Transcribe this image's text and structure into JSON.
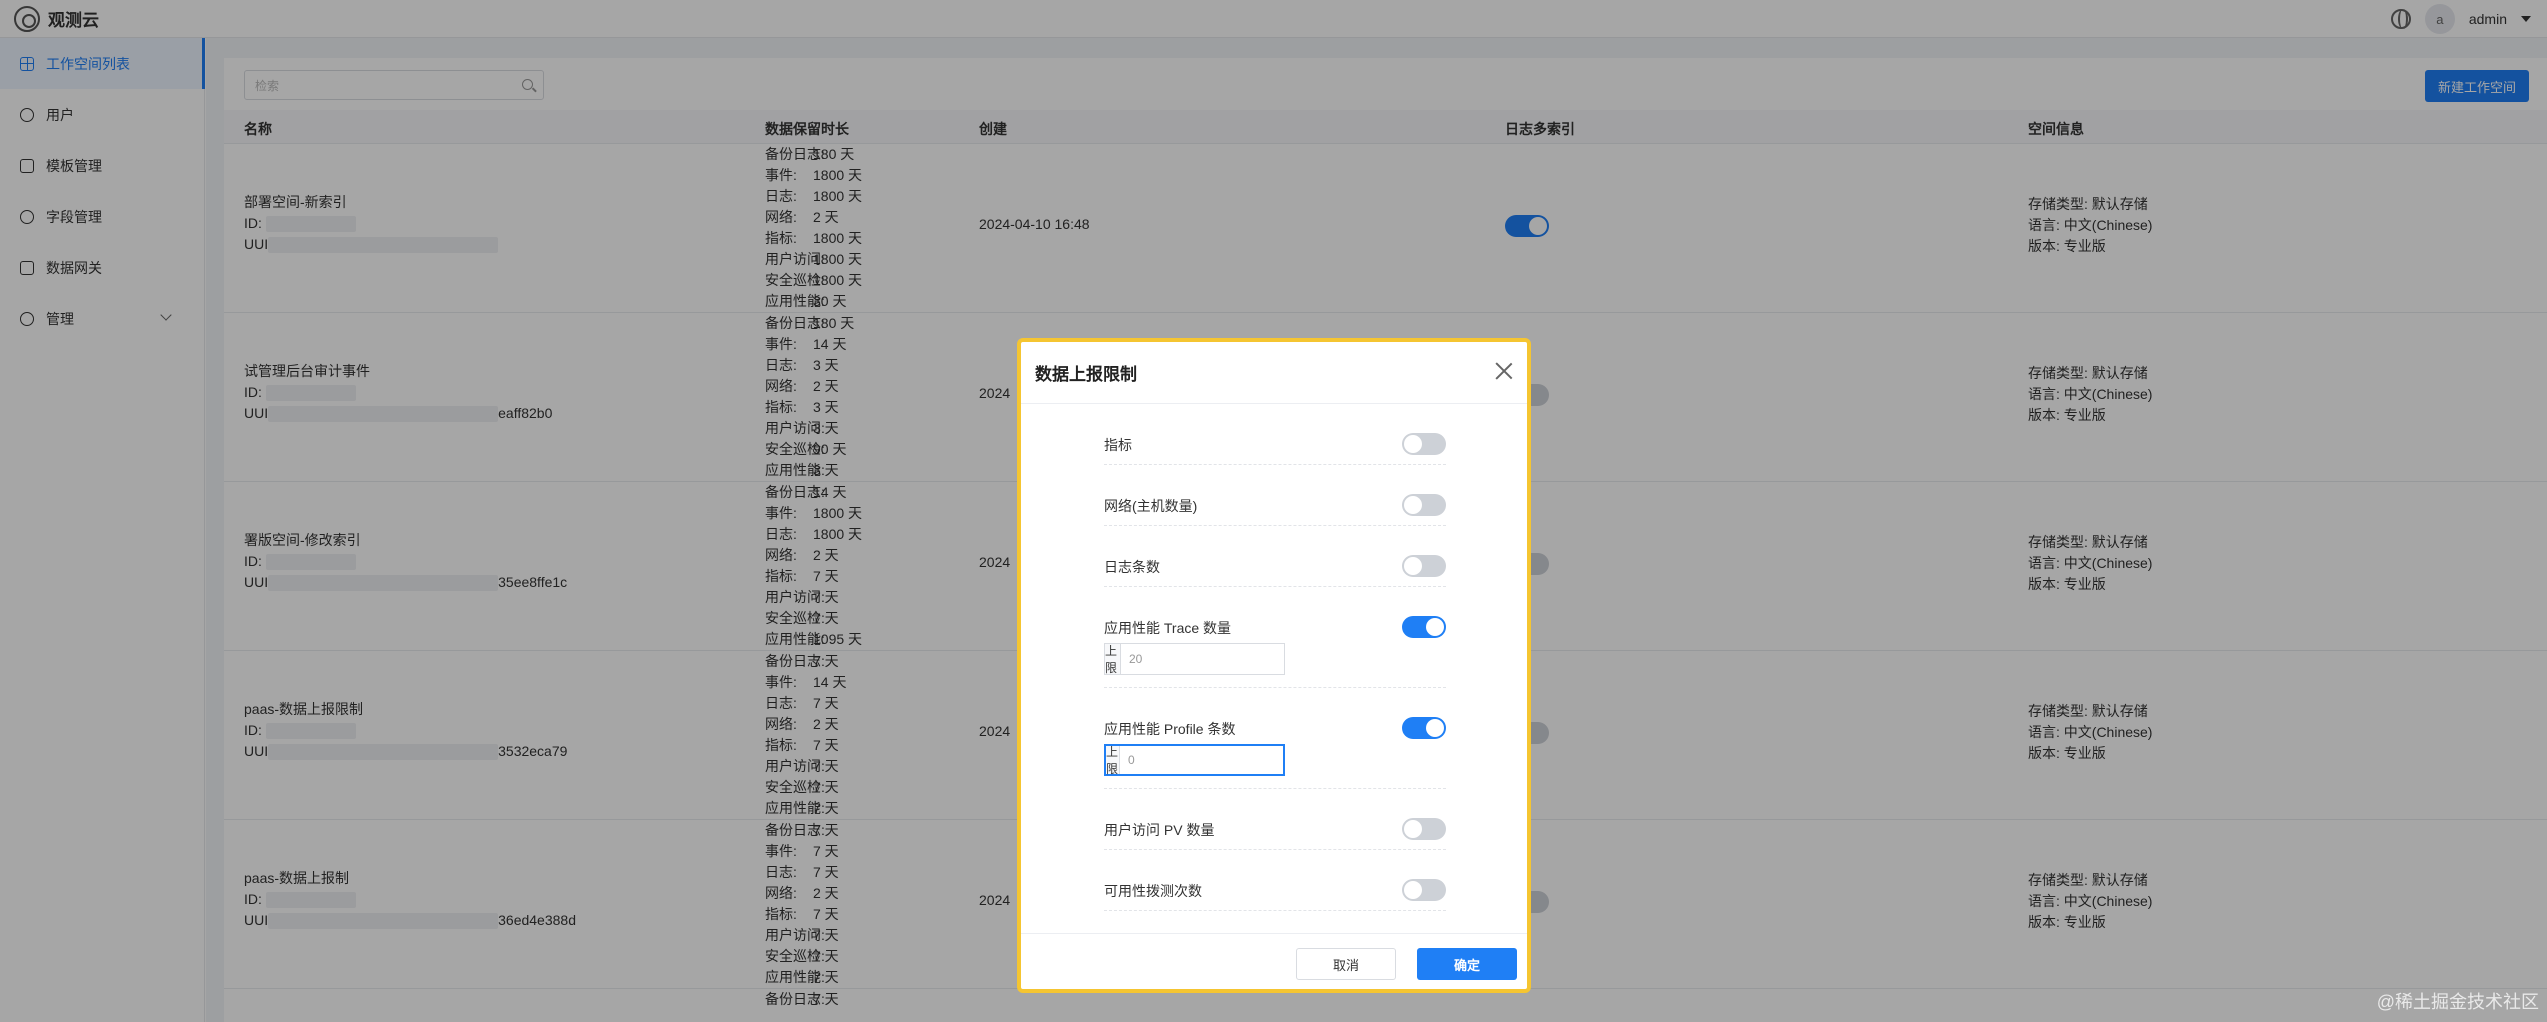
{
  "app": {
    "title": "观测云"
  },
  "header": {
    "user_initial": "a",
    "user_name": "admin",
    "icons": [
      "globe-icon",
      "chevron-down-icon"
    ]
  },
  "sidebar": {
    "items": [
      {
        "label": "工作空间列表",
        "icon": "grid-icon",
        "active": true
      },
      {
        "label": "用户",
        "icon": "users-icon"
      },
      {
        "label": "模板管理",
        "icon": "tag-icon"
      },
      {
        "label": "字段管理",
        "icon": "users-icon"
      },
      {
        "label": "数据网关",
        "icon": "lock-icon"
      },
      {
        "label": "管理",
        "icon": "settings-icon"
      }
    ]
  },
  "toolbar": {
    "search_placeholder": "检索",
    "new_button": "新建工作空间"
  },
  "table": {
    "headers": [
      "名称",
      "数据保留时长",
      "创建",
      "日志多索引",
      "空间信息"
    ],
    "rows": [
      {
        "name": "部署空间-新索引",
        "id_label": "ID:",
        "uuid_label": "UUI",
        "uuid_tail": "",
        "retention": [
          {
            "k": "备份日志:",
            "v": "180 天"
          },
          {
            "k": "事件:",
            "v": "1800 天"
          },
          {
            "k": "日志:",
            "v": "1800 天"
          },
          {
            "k": "网络:",
            "v": "2 天"
          },
          {
            "k": "指标:",
            "v": "1800 天"
          },
          {
            "k": "用户访问:",
            "v": "1800 天"
          },
          {
            "k": "安全巡检:",
            "v": "1800 天"
          },
          {
            "k": "应用性能:",
            "v": "30 天"
          }
        ],
        "created": "2024-04-10 16:48",
        "multi_index": true,
        "info": [
          "存储类型: 默认存储",
          "语言: 中文(Chinese)",
          "版本: 专业版"
        ]
      },
      {
        "name": "试管理后台审计事件",
        "id_label": "ID:",
        "uuid_label": "UUI",
        "uuid_tail": "eaff82b0",
        "retention": [
          {
            "k": "备份日志:",
            "v": "180 天"
          },
          {
            "k": "事件:",
            "v": "14 天"
          },
          {
            "k": "日志:",
            "v": "3 天"
          },
          {
            "k": "网络:",
            "v": "2 天"
          },
          {
            "k": "指标:",
            "v": "3 天"
          },
          {
            "k": "用户访问:",
            "v": "3 天"
          },
          {
            "k": "安全巡检:",
            "v": "90 天"
          },
          {
            "k": "应用性能:",
            "v": "3 天"
          }
        ],
        "created": "2024",
        "multi_index": false,
        "info": [
          "存储类型: 默认存储",
          "语言: 中文(Chinese)",
          "版本: 专业版"
        ]
      },
      {
        "name": "署版空间-修改索引",
        "id_label": "ID:",
        "uuid_label": "UUI",
        "uuid_tail": "35ee8ffe1c",
        "retention": [
          {
            "k": "备份日志:",
            "v": "14 天"
          },
          {
            "k": "事件:",
            "v": "1800 天"
          },
          {
            "k": "日志:",
            "v": "1800 天"
          },
          {
            "k": "网络:",
            "v": "2 天"
          },
          {
            "k": "指标:",
            "v": "7 天"
          },
          {
            "k": "用户访问:",
            "v": "7 天"
          },
          {
            "k": "安全巡检:",
            "v": "7 天"
          },
          {
            "k": "应用性能:",
            "v": "1095 天"
          }
        ],
        "created": "2024",
        "multi_index": false,
        "info": [
          "存储类型: 默认存储",
          "语言: 中文(Chinese)",
          "版本: 专业版"
        ]
      },
      {
        "name": "paas-数据上报限制",
        "id_label": "ID:",
        "uuid_label": "UUI",
        "uuid_tail": "3532eca79",
        "retention": [
          {
            "k": "备份日志:",
            "v": "7 天"
          },
          {
            "k": "事件:",
            "v": "14 天"
          },
          {
            "k": "日志:",
            "v": "7 天"
          },
          {
            "k": "网络:",
            "v": "2 天"
          },
          {
            "k": "指标:",
            "v": "7 天"
          },
          {
            "k": "用户访问:",
            "v": "7 天"
          },
          {
            "k": "安全巡检:",
            "v": "7 天"
          },
          {
            "k": "应用性能:",
            "v": "7 天"
          }
        ],
        "created": "2024",
        "multi_index": false,
        "info": [
          "存储类型: 默认存储",
          "语言: 中文(Chinese)",
          "版本: 专业版"
        ]
      },
      {
        "name": "paas-数据上报制",
        "id_label": "ID:",
        "uuid_label": "UUI",
        "uuid_tail": "36ed4e388d",
        "retention": [
          {
            "k": "备份日志:",
            "v": "7 天"
          },
          {
            "k": "事件:",
            "v": "7 天"
          },
          {
            "k": "日志:",
            "v": "7 天"
          },
          {
            "k": "网络:",
            "v": "2 天"
          },
          {
            "k": "指标:",
            "v": "7 天"
          },
          {
            "k": "用户访问:",
            "v": "7 天"
          },
          {
            "k": "安全巡检:",
            "v": "7 天"
          },
          {
            "k": "应用性能:",
            "v": "7 天"
          }
        ],
        "created": "2024",
        "multi_index": false,
        "info": [
          "存储类型: 默认存储",
          "语言: 中文(Chinese)",
          "版本: 专业版"
        ]
      }
    ],
    "partial_row": {
      "k": "备份日志:",
      "v": "7 天"
    }
  },
  "modal": {
    "title": "数据上报限制",
    "items": [
      {
        "label": "指标",
        "on": false
      },
      {
        "label": "网络(主机数量)",
        "on": false
      },
      {
        "label": "日志条数",
        "on": false
      },
      {
        "label": "应用性能 Trace 数量",
        "on": true,
        "cap_label": "上限",
        "cap_value": "20"
      },
      {
        "label": "应用性能 Profile 条数",
        "on": true,
        "cap_label": "上限",
        "cap_value": "0"
      },
      {
        "label": "用户访问 PV 数量",
        "on": false
      },
      {
        "label": "可用性拨测次数",
        "on": false
      }
    ],
    "cancel": "取消",
    "ok": "确定"
  },
  "watermark": "@稀土掘金技术社区",
  "colors": {
    "accent": "#1f7ff5",
    "highlight_border": "#f5c531"
  }
}
